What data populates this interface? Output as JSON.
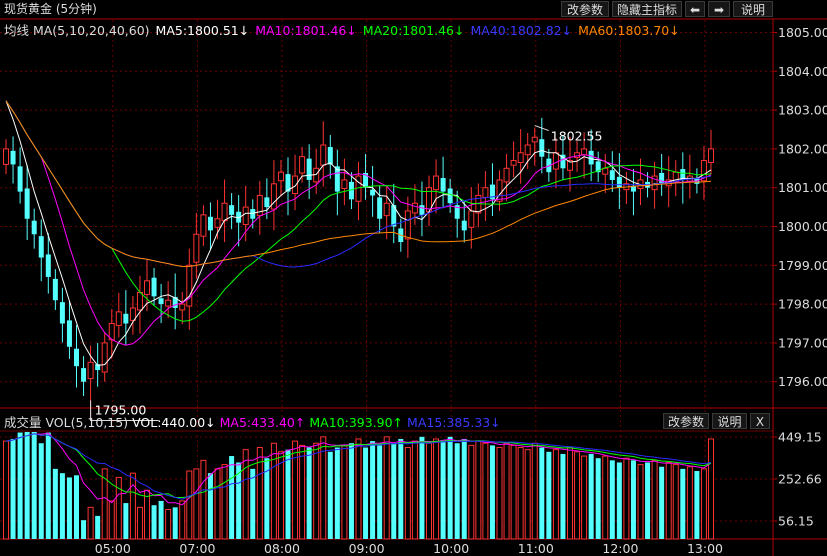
{
  "header": {
    "title": "现货黄金 (5分钟)",
    "buttons": [
      "改参数",
      "隐藏主指标",
      "⬅",
      "➡",
      "说明"
    ]
  },
  "price_legend": {
    "prefix": "均线 MA(5,10,20,40,60)",
    "ma5": "MA5:1800.51↓",
    "ma10": "MA10:1801.46↓",
    "ma20": "MA20:1801.46↓",
    "ma40": "MA40:1802.82↓",
    "ma60": "MA60:1803.70↓"
  },
  "volume_legend": {
    "prefix": "成交量 VOL(5,10,15)",
    "vol": "VOL:440.00↓",
    "ma5": "MA5:433.40↑",
    "ma10": "MA10:393.90↑",
    "ma15": "MA15:385.33↓",
    "buttons": [
      "改参数",
      "说明",
      "X"
    ]
  },
  "annotations": {
    "high": "1802.55",
    "low": "1795.00"
  },
  "colors": {
    "up": "#ff3232",
    "down": "#54ffff",
    "ma5": "#ffffff",
    "ma10": "#ff00ff",
    "ma20": "#00ff00",
    "ma40": "#2a2aff",
    "ma60": "#ff8800",
    "grid": "#6b0000",
    "axis": "#b00000"
  },
  "chart_data": [
    {
      "type": "candlestick",
      "title": "现货黄金 (5分钟)",
      "ylim": [
        1795.0,
        1805.3
      ],
      "yticks": [
        1796.0,
        1797.0,
        1798.0,
        1799.0,
        1800.0,
        1801.0,
        1802.0,
        1803.0,
        1804.0,
        1805.0
      ],
      "ytick_labels": [
        "1796.00",
        "1797.00",
        "1798.00",
        "1799.00",
        "1800.00",
        "1801.00",
        "1802.00",
        "1803.00",
        "1804.00",
        "1805.00"
      ],
      "xtick_labels": [
        "05:00",
        "07:00",
        "08:00",
        "09:00",
        "10:00",
        "11:00",
        "12:00",
        "13:00"
      ],
      "xtick_index": [
        16,
        28,
        40,
        52,
        64,
        76,
        88,
        100
      ],
      "annotations": [
        {
          "index": 75,
          "value": 1802.55
        },
        {
          "index": 12,
          "value": 1795.0
        }
      ],
      "close": [
        1802.0,
        1801.6,
        1800.9,
        1800.2,
        1799.8,
        1799.2,
        1798.7,
        1798.1,
        1797.5,
        1796.9,
        1796.4,
        1796.0,
        1796.5,
        1796.3,
        1797.0,
        1797.5,
        1797.8,
        1797.5,
        1797.9,
        1798.3,
        1798.6,
        1798.2,
        1798.0,
        1798.1,
        1797.9,
        1798.0,
        1799.0,
        1799.8,
        1800.3,
        1799.9,
        1800.2,
        1800.6,
        1800.3,
        1800.1,
        1800.5,
        1800.2,
        1800.8,
        1800.5,
        1801.1,
        1801.4,
        1800.9,
        1801.3,
        1801.8,
        1801.2,
        1801.5,
        1802.1,
        1801.6,
        1800.9,
        1801.2,
        1800.7,
        1801.3,
        1801.0,
        1800.8,
        1800.2,
        1800.6,
        1800.0,
        1799.6,
        1800.4,
        1800.6,
        1800.3,
        1801.0,
        1801.3,
        1800.9,
        1800.6,
        1800.2,
        1799.9,
        1800.4,
        1800.8,
        1801.0,
        1800.7,
        1801.2,
        1801.5,
        1801.7,
        1801.9,
        1802.1,
        1802.3,
        1801.8,
        1801.4,
        1801.9,
        1801.5,
        1801.7,
        1801.9,
        1802.0,
        1801.6,
        1801.4,
        1801.5,
        1801.2,
        1801.0,
        1801.1,
        1800.9,
        1801.2,
        1801.0,
        1801.3,
        1801.1,
        1801.2,
        1801.4,
        1801.2,
        1801.3,
        1801.1,
        1801.7,
        1802.0
      ],
      "volume": [
        430,
        440,
        470,
        480,
        500,
        420,
        470,
        300,
        280,
        260,
        270,
        60,
        120,
        80,
        300,
        150,
        260,
        140,
        280,
        120,
        200,
        130,
        150,
        110,
        120,
        150,
        290,
        300,
        340,
        280,
        300,
        320,
        360,
        330,
        390,
        300,
        400,
        350,
        420,
        380,
        390,
        430,
        410,
        400,
        420,
        450,
        380,
        400,
        410,
        420,
        440,
        400,
        430,
        410,
        450,
        420,
        440,
        400,
        430,
        450,
        420,
        440,
        430,
        450,
        420,
        440,
        410,
        430,
        420,
        410,
        400,
        420,
        410,
        400,
        390,
        420,
        400,
        380,
        390,
        370,
        400,
        380,
        360,
        370,
        350,
        360,
        340,
        330,
        350,
        340,
        320,
        330,
        340,
        310,
        330,
        320,
        300,
        310,
        290,
        300,
        440
      ]
    },
    {
      "type": "bar",
      "title": "成交量",
      "yticks": [
        56.15,
        252.66,
        449.15
      ],
      "ytick_labels": [
        "56.15",
        "252.66",
        "449.15"
      ]
    }
  ]
}
